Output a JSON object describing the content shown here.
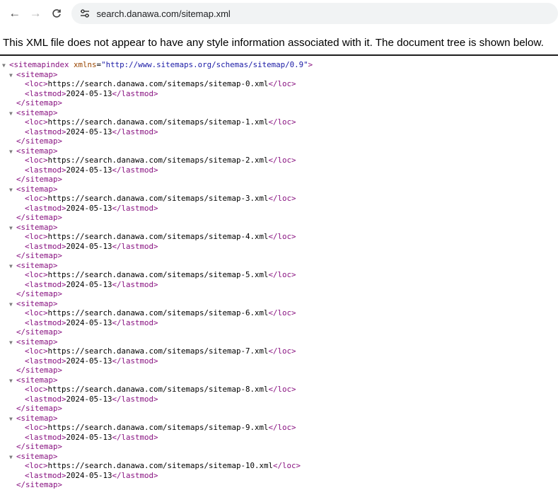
{
  "browser": {
    "url": "search.danawa.com/sitemap.xml",
    "back_icon": "arrow-left-icon",
    "forward_icon": "arrow-right-icon",
    "reload_icon": "reload-icon",
    "site_info_icon": "tune-icon"
  },
  "info_message": "This XML file does not appear to have any style information associated with it. The document tree is shown below.",
  "xml": {
    "root_open_tag": "<sitemapindex",
    "root_attr_name": "xmlns",
    "root_attr_value": "\"http://www.sitemaps.org/schemas/sitemap/0.9\"",
    "root_open_close": ">",
    "sitemap_open": "<sitemap>",
    "sitemap_close": "</sitemap>",
    "loc_open": "<loc>",
    "loc_close": "</loc>",
    "lastmod_open": "<lastmod>",
    "lastmod_close": "</lastmod>",
    "toggle_glyph": "▼",
    "sitemaps": [
      {
        "loc": "https://search.danawa.com/sitemaps/sitemap-0.xml",
        "lastmod": "2024-05-13"
      },
      {
        "loc": "https://search.danawa.com/sitemaps/sitemap-1.xml",
        "lastmod": "2024-05-13"
      },
      {
        "loc": "https://search.danawa.com/sitemaps/sitemap-2.xml",
        "lastmod": "2024-05-13"
      },
      {
        "loc": "https://search.danawa.com/sitemaps/sitemap-3.xml",
        "lastmod": "2024-05-13"
      },
      {
        "loc": "https://search.danawa.com/sitemaps/sitemap-4.xml",
        "lastmod": "2024-05-13"
      },
      {
        "loc": "https://search.danawa.com/sitemaps/sitemap-5.xml",
        "lastmod": "2024-05-13"
      },
      {
        "loc": "https://search.danawa.com/sitemaps/sitemap-6.xml",
        "lastmod": "2024-05-13"
      },
      {
        "loc": "https://search.danawa.com/sitemaps/sitemap-7.xml",
        "lastmod": "2024-05-13"
      },
      {
        "loc": "https://search.danawa.com/sitemaps/sitemap-8.xml",
        "lastmod": "2024-05-13"
      },
      {
        "loc": "https://search.danawa.com/sitemaps/sitemap-9.xml",
        "lastmod": "2024-05-13"
      },
      {
        "loc": "https://search.danawa.com/sitemaps/sitemap-10.xml",
        "lastmod": "2024-05-13"
      }
    ]
  }
}
